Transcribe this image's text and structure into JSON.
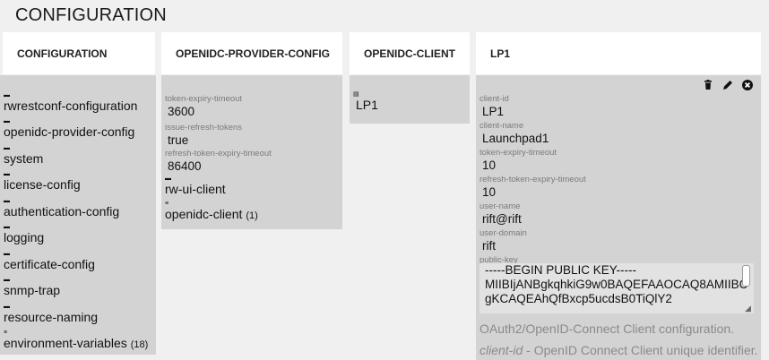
{
  "page": {
    "title": "CONFIGURATION"
  },
  "columns": [
    {
      "header": "CONFIGURATION"
    },
    {
      "header": "OPENIDC-PROVIDER-CONFIG"
    },
    {
      "header": "OPENIDC-CLIENT"
    },
    {
      "header": "LP1"
    }
  ],
  "configuration_items": [
    {
      "label": "rwrestconf-configuration",
      "icon": "container-icon"
    },
    {
      "label": "openidc-provider-config",
      "icon": "container-icon"
    },
    {
      "label": "system",
      "icon": "container-icon"
    },
    {
      "label": "license-config",
      "icon": "container-icon"
    },
    {
      "label": "authentication-config",
      "icon": "container-icon"
    },
    {
      "label": "logging",
      "icon": "container-icon"
    },
    {
      "label": "certificate-config",
      "icon": "container-icon"
    },
    {
      "label": "snmp-trap",
      "icon": "container-icon"
    },
    {
      "label": "resource-naming",
      "icon": "container-icon"
    },
    {
      "label": "environment-variables",
      "icon": "list-icon",
      "count": "(18)"
    }
  ],
  "provider_config": {
    "fields": [
      {
        "label": "token-expiry-timeout",
        "value": "3600"
      },
      {
        "label": "issue-refresh-tokens",
        "value": "true"
      },
      {
        "label": "refresh-token-expiry-timeout",
        "value": "86400"
      }
    ],
    "items": [
      {
        "label": "rw-ui-client",
        "icon": "container-icon"
      },
      {
        "label": "openidc-client",
        "icon": "list-icon",
        "count": "(1)"
      }
    ]
  },
  "openidc_client": {
    "items": [
      {
        "label": "LP1",
        "icon": "list-entry-icon"
      }
    ]
  },
  "lp1": {
    "actions": [
      "trash-icon",
      "pencil-icon",
      "close-circle-icon"
    ],
    "fields": [
      {
        "label": "client-id",
        "value": "LP1"
      },
      {
        "label": "client-name",
        "value": "Launchpad1"
      },
      {
        "label": "token-expiry-timeout",
        "value": "10"
      },
      {
        "label": "refresh-token-expiry-timeout",
        "value": "10"
      },
      {
        "label": "user-name",
        "value": "rift@rift"
      },
      {
        "label": "user-domain",
        "value": "rift"
      },
      {
        "label": "public-key"
      }
    ],
    "public_key_lines": [
      "-----BEGIN PUBLIC KEY-----",
      "MIIBIjANBgkqhkiG9w0BAQEFAAOCAQ8AMIIBC",
      "gKCAQEAhQfBxcp5ucdsB0TiQlY2"
    ],
    "help": {
      "description": "OAuth2/OpenID-Connect Client configuration.",
      "key": "client-id",
      "key_description": " - OpenID Connect Client unique identifier."
    }
  }
}
